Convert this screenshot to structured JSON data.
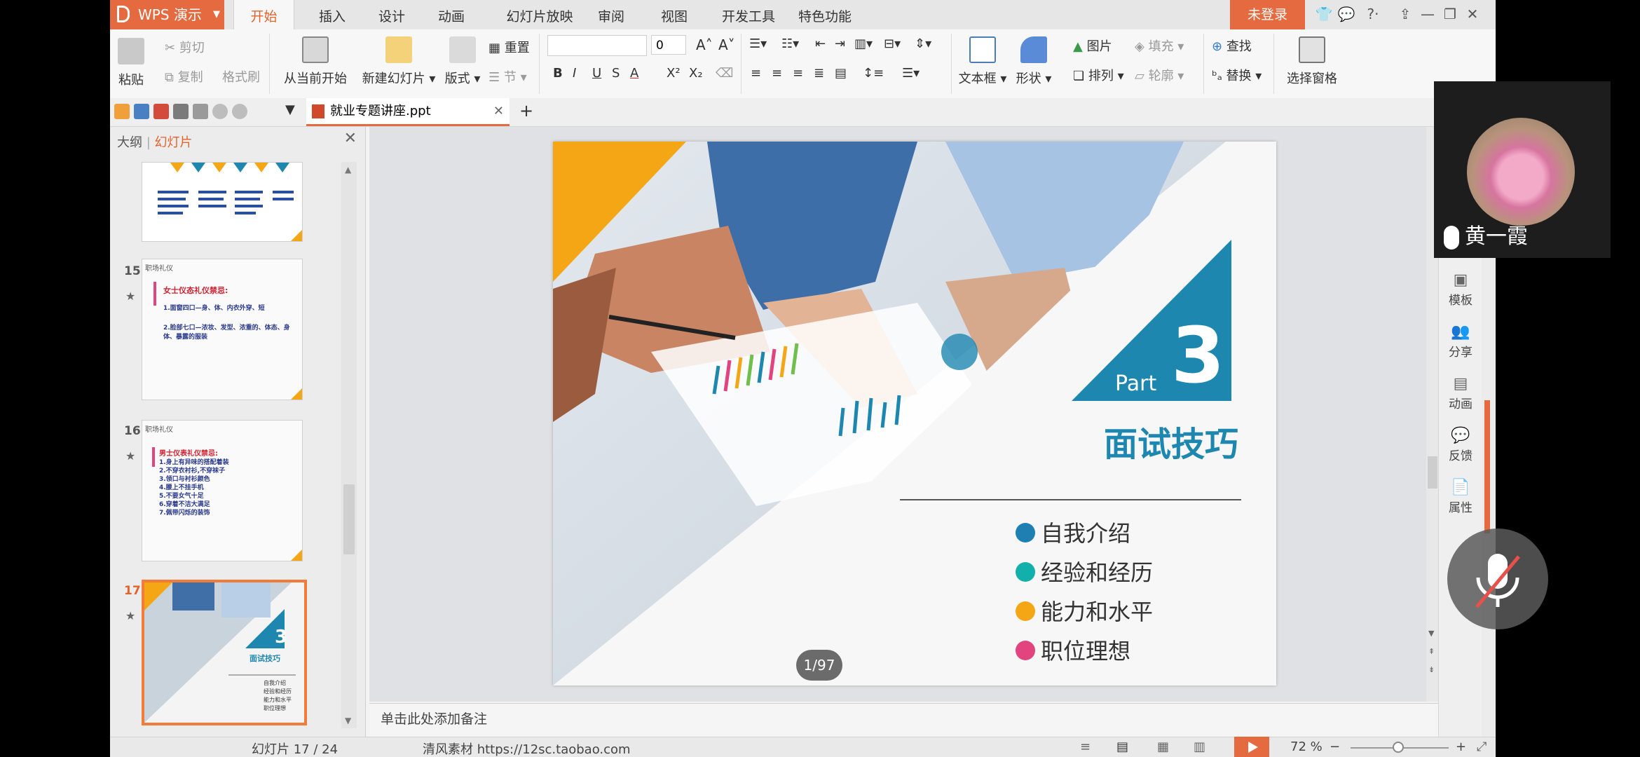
{
  "app": {
    "logo_label": "WPS 演示",
    "tabs": [
      "开始",
      "插入",
      "设计",
      "动画",
      "幻灯片放映",
      "审阅",
      "视图",
      "开发工具",
      "特色功能"
    ],
    "active_tab": "开始",
    "login_label": "未登录"
  },
  "ribbon": {
    "paste": "粘贴",
    "cut": "剪切",
    "copy": "复制",
    "format_painter": "格式刷",
    "from_current": "从当前开始",
    "new_slide": "新建幻灯片",
    "layout": "版式",
    "reset": "重置",
    "section": "节",
    "font_size": "0",
    "textbox": "文本框",
    "shape": "形状",
    "picture": "图片",
    "arrange": "排列",
    "fill": "填充",
    "outline": "轮廓",
    "find": "查找",
    "replace": "替换",
    "selection_pane": "选择窗格"
  },
  "document": {
    "tab_name": "就业专题讲座.ppt"
  },
  "left_panel": {
    "outline_tab": "大纲",
    "slides_tab": "幻灯片",
    "thumbnails": [
      {
        "number": "",
        "title": "",
        "lines": []
      },
      {
        "number": "15",
        "header": "职场礼仪",
        "title": "女士仪态礼仪禁忌:",
        "lines": [
          "1.面窗四口—身、体、内衣外穿、短",
          "2.脸部七口—浓妆、发型、浓重的、体态、身体、暴露的服装"
        ]
      },
      {
        "number": "16",
        "header": "职场礼仪",
        "title": "男士仪表礼仪禁忌:",
        "lines": [
          "1.身上有异味的搭配着装",
          "2.不穿衣衬衫,不穿袜子",
          "3.领口与衬衫颜色",
          "4.腰上不挂手机",
          "5.不要女气十足",
          "6.穿着不洁大满足",
          "7.佩带闪烁的装饰"
        ]
      },
      {
        "number": "17",
        "title": "面试技巧",
        "lines": [
          "自我介绍",
          "经验和经历",
          "能力和水平",
          "职位理想"
        ]
      }
    ]
  },
  "slide": {
    "part_label": "Part",
    "part_number": "3",
    "title": "面试技巧",
    "bullets": [
      {
        "text": "自我介绍",
        "color": "#1e7fb2"
      },
      {
        "text": "经验和经历",
        "color": "#12b0ab"
      },
      {
        "text": "能力和水平",
        "color": "#f5a615"
      },
      {
        "text": "职位理想",
        "color": "#e2447f"
      }
    ],
    "page_chip": "1/97"
  },
  "notes_placeholder": "单击此处添加备注",
  "right_sidebar": [
    "模板",
    "分享",
    "动画",
    "反馈",
    "属性"
  ],
  "status": {
    "slide_counter": "幻灯片 17 / 24",
    "source": "清风素材 https://12sc.taobao.com",
    "zoom": "72 %"
  },
  "video_overlay": {
    "name": "黄一霞"
  },
  "colors": {
    "accent": "#e56a3f",
    "teal": "#1e87b0",
    "orange": "#f5a615"
  }
}
